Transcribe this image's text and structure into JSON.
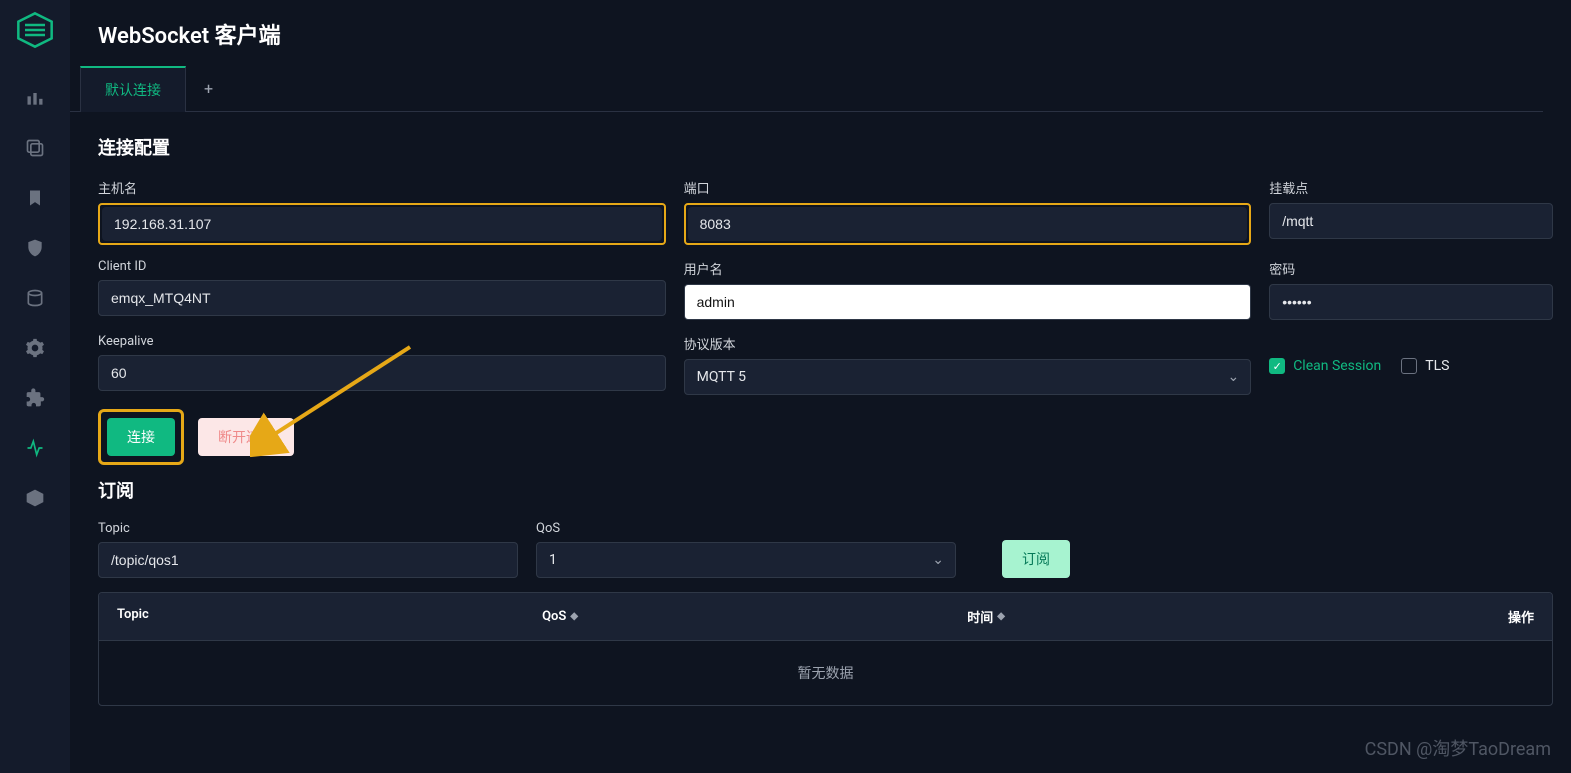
{
  "header": {
    "title": "WebSocket 客户端"
  },
  "tabs": {
    "active": "默认连接",
    "add": "+"
  },
  "connection": {
    "title": "连接配置",
    "labels": {
      "host": "主机名",
      "port": "端口",
      "mount": "挂载点",
      "client_id": "Client ID",
      "username": "用户名",
      "password": "密码",
      "keepalive": "Keepalive",
      "protocol": "协议版本",
      "clean_session": "Clean Session",
      "tls": "TLS"
    },
    "values": {
      "host": "192.168.31.107",
      "port": "8083",
      "mount": "/mqtt",
      "client_id": "emqx_MTQ4NT",
      "username": "admin",
      "password": "······",
      "keepalive": "60",
      "protocol": "MQTT 5",
      "clean_session": true,
      "tls": false
    },
    "buttons": {
      "connect": "连接",
      "disconnect": "断开连接"
    }
  },
  "subscribe": {
    "title": "订阅",
    "labels": {
      "topic": "Topic",
      "qos": "QoS"
    },
    "values": {
      "topic": "/topic/qos1",
      "qos": "1"
    },
    "button": "订阅",
    "table": {
      "columns": {
        "topic": "Topic",
        "qos": "QoS",
        "time": "时间",
        "action": "操作"
      },
      "empty": "暂无数据"
    }
  },
  "watermark": "CSDN @淘梦TaoDream"
}
